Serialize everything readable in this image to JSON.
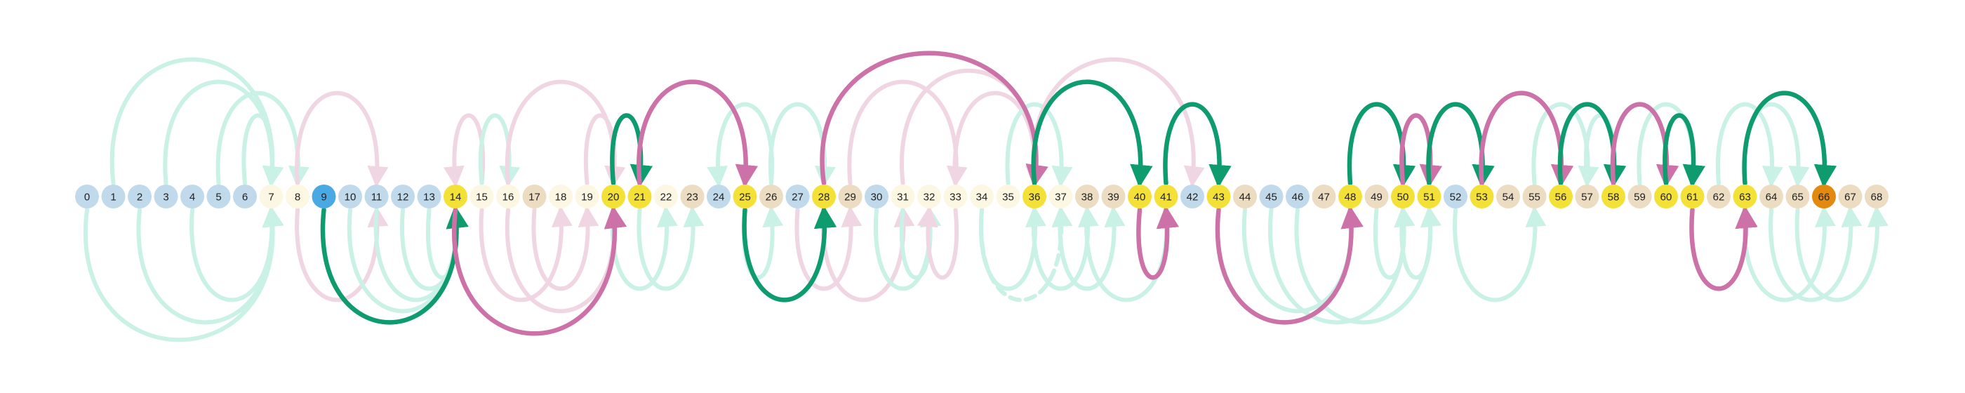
{
  "colors": {
    "green": "#0e9b6e",
    "pink": "#cc72a8",
    "ghost_green": "#c9f1e5",
    "ghost_pink": "#efd6e2",
    "node_blue": "#c0d9eb",
    "node_cream": "#fbf7e2",
    "node_tan": "#ecdcc2",
    "node_yellow": "#f4e137",
    "node_start": "#4aa9e2",
    "node_goal": "#e3890f"
  },
  "nodes": [
    {
      "label": "0",
      "kind": "blue"
    },
    {
      "label": "1",
      "kind": "blue"
    },
    {
      "label": "2",
      "kind": "blue"
    },
    {
      "label": "3",
      "kind": "blue"
    },
    {
      "label": "4",
      "kind": "blue"
    },
    {
      "label": "5",
      "kind": "blue"
    },
    {
      "label": "6",
      "kind": "blue"
    },
    {
      "label": "7",
      "kind": "cream"
    },
    {
      "label": "8",
      "kind": "cream"
    },
    {
      "label": "9",
      "kind": "start"
    },
    {
      "label": "10",
      "kind": "blue"
    },
    {
      "label": "11",
      "kind": "blue"
    },
    {
      "label": "12",
      "kind": "blue"
    },
    {
      "label": "13",
      "kind": "blue"
    },
    {
      "label": "14",
      "kind": "yellow"
    },
    {
      "label": "15",
      "kind": "cream"
    },
    {
      "label": "16",
      "kind": "cream"
    },
    {
      "label": "17",
      "kind": "tan"
    },
    {
      "label": "18",
      "kind": "cream"
    },
    {
      "label": "19",
      "kind": "cream"
    },
    {
      "label": "20",
      "kind": "yellow"
    },
    {
      "label": "21",
      "kind": "yellow"
    },
    {
      "label": "22",
      "kind": "cream"
    },
    {
      "label": "23",
      "kind": "tan"
    },
    {
      "label": "24",
      "kind": "blue"
    },
    {
      "label": "25",
      "kind": "yellow"
    },
    {
      "label": "26",
      "kind": "tan"
    },
    {
      "label": "27",
      "kind": "blue"
    },
    {
      "label": "28",
      "kind": "yellow"
    },
    {
      "label": "29",
      "kind": "tan"
    },
    {
      "label": "30",
      "kind": "blue"
    },
    {
      "label": "31",
      "kind": "cream"
    },
    {
      "label": "32",
      "kind": "cream"
    },
    {
      "label": "33",
      "kind": "cream"
    },
    {
      "label": "34",
      "kind": "cream"
    },
    {
      "label": "35",
      "kind": "cream"
    },
    {
      "label": "36",
      "kind": "yellow"
    },
    {
      "label": "37",
      "kind": "cream"
    },
    {
      "label": "38",
      "kind": "tan"
    },
    {
      "label": "39",
      "kind": "tan"
    },
    {
      "label": "40",
      "kind": "yellow"
    },
    {
      "label": "41",
      "kind": "yellow"
    },
    {
      "label": "42",
      "kind": "blue"
    },
    {
      "label": "43",
      "kind": "yellow"
    },
    {
      "label": "44",
      "kind": "tan"
    },
    {
      "label": "45",
      "kind": "blue"
    },
    {
      "label": "46",
      "kind": "blue"
    },
    {
      "label": "47",
      "kind": "tan"
    },
    {
      "label": "48",
      "kind": "yellow"
    },
    {
      "label": "49",
      "kind": "tan"
    },
    {
      "label": "50",
      "kind": "yellow"
    },
    {
      "label": "51",
      "kind": "yellow"
    },
    {
      "label": "52",
      "kind": "blue"
    },
    {
      "label": "53",
      "kind": "yellow"
    },
    {
      "label": "54",
      "kind": "tan"
    },
    {
      "label": "55",
      "kind": "tan"
    },
    {
      "label": "56",
      "kind": "yellow"
    },
    {
      "label": "57",
      "kind": "tan"
    },
    {
      "label": "58",
      "kind": "yellow"
    },
    {
      "label": "59",
      "kind": "tan"
    },
    {
      "label": "60",
      "kind": "yellow"
    },
    {
      "label": "61",
      "kind": "yellow"
    },
    {
      "label": "62",
      "kind": "tan"
    },
    {
      "label": "63",
      "kind": "yellow"
    },
    {
      "label": "64",
      "kind": "tan"
    },
    {
      "label": "65",
      "kind": "tan"
    },
    {
      "label": "66",
      "kind": "goal"
    },
    {
      "label": "67",
      "kind": "tan"
    },
    {
      "label": "68",
      "kind": "tan"
    }
  ],
  "arcs_highlight": [
    {
      "from": 9,
      "to": 14,
      "side": "below",
      "color": "green"
    },
    {
      "from": 14,
      "to": 20,
      "side": "below",
      "color": "pink"
    },
    {
      "from": 20,
      "to": 21,
      "side": "above",
      "color": "green"
    },
    {
      "from": 21,
      "to": 25,
      "side": "above",
      "color": "pink"
    },
    {
      "from": 25,
      "to": 28,
      "side": "below",
      "color": "green"
    },
    {
      "from": 28,
      "to": 36,
      "side": "above",
      "color": "pink"
    },
    {
      "from": 36,
      "to": 40,
      "side": "above",
      "color": "green"
    },
    {
      "from": 40,
      "to": 41,
      "side": "below",
      "color": "pink"
    },
    {
      "from": 41,
      "to": 43,
      "side": "above",
      "color": "green"
    },
    {
      "from": 43,
      "to": 48,
      "side": "below",
      "color": "pink"
    },
    {
      "from": 48,
      "to": 50,
      "side": "above",
      "color": "green"
    },
    {
      "from": 50,
      "to": 51,
      "side": "above",
      "color": "pink"
    },
    {
      "from": 51,
      "to": 53,
      "side": "above",
      "color": "green"
    },
    {
      "from": 53,
      "to": 56,
      "side": "above",
      "color": "pink"
    },
    {
      "from": 56,
      "to": 58,
      "side": "above",
      "color": "green"
    },
    {
      "from": 58,
      "to": 60,
      "side": "above",
      "color": "pink"
    },
    {
      "from": 60,
      "to": 61,
      "side": "above",
      "color": "green"
    },
    {
      "from": 61,
      "to": 63,
      "side": "below",
      "color": "pink"
    },
    {
      "from": 63,
      "to": 66,
      "side": "above",
      "color": "green"
    }
  ],
  "arcs_ghost": [
    {
      "from": 1,
      "to": 7,
      "side": "above",
      "color": "ghost_green"
    },
    {
      "from": 3,
      "to": 7,
      "side": "above",
      "color": "ghost_green"
    },
    {
      "from": 5,
      "to": 8,
      "side": "above",
      "color": "ghost_green"
    },
    {
      "from": 6,
      "to": 7,
      "side": "above",
      "color": "ghost_green"
    },
    {
      "from": 8,
      "to": 11,
      "side": "above",
      "color": "ghost_pink"
    },
    {
      "from": 0,
      "to": 7,
      "side": "below",
      "color": "ghost_green"
    },
    {
      "from": 2,
      "to": 7,
      "side": "below",
      "color": "ghost_green"
    },
    {
      "from": 4,
      "to": 7,
      "side": "below",
      "color": "ghost_green"
    },
    {
      "from": 8,
      "to": 11,
      "side": "below",
      "color": "ghost_pink"
    },
    {
      "from": 10,
      "to": 14,
      "side": "below",
      "color": "ghost_green"
    },
    {
      "from": 11,
      "to": 14,
      "side": "below",
      "color": "ghost_green"
    },
    {
      "from": 12,
      "to": 14,
      "side": "below",
      "color": "ghost_green"
    },
    {
      "from": 13,
      "to": 14,
      "side": "below",
      "color": "ghost_green"
    },
    {
      "from": 15,
      "to": 14,
      "side": "above",
      "color": "ghost_pink"
    },
    {
      "from": 15,
      "to": 16,
      "side": "above",
      "color": "ghost_green"
    },
    {
      "from": 16,
      "to": 20,
      "side": "above",
      "color": "ghost_pink"
    },
    {
      "from": 19,
      "to": 20,
      "side": "above",
      "color": "ghost_pink"
    },
    {
      "from": 21,
      "to": 25,
      "side": "above",
      "color": "ghost_pink"
    },
    {
      "from": 15,
      "to": 18,
      "side": "below",
      "color": "ghost_pink"
    },
    {
      "from": 16,
      "to": 20,
      "side": "below",
      "color": "ghost_pink"
    },
    {
      "from": 17,
      "to": 19,
      "side": "below",
      "color": "ghost_pink"
    },
    {
      "from": 20,
      "to": 22,
      "side": "below",
      "color": "ghost_green"
    },
    {
      "from": 21,
      "to": 23,
      "side": "below",
      "color": "ghost_green"
    },
    {
      "from": 26,
      "to": 28,
      "side": "above",
      "color": "ghost_green"
    },
    {
      "from": 26,
      "to": 24,
      "side": "above",
      "color": "ghost_green"
    },
    {
      "from": 29,
      "to": 33,
      "side": "above",
      "color": "ghost_pink"
    },
    {
      "from": 31,
      "to": 36,
      "side": "above",
      "color": "ghost_pink"
    },
    {
      "from": 33,
      "to": 36,
      "side": "above",
      "color": "ghost_pink"
    },
    {
      "from": 35,
      "to": 37,
      "side": "above",
      "color": "ghost_green"
    },
    {
      "from": 36,
      "to": 42,
      "side": "above",
      "color": "ghost_pink"
    },
    {
      "from": 25,
      "to": 26,
      "side": "below",
      "color": "ghost_green"
    },
    {
      "from": 27,
      "to": 29,
      "side": "below",
      "color": "ghost_pink"
    },
    {
      "from": 28,
      "to": 31,
      "side": "below",
      "color": "ghost_pink"
    },
    {
      "from": 30,
      "to": 32,
      "side": "below",
      "color": "ghost_green"
    },
    {
      "from": 31,
      "to": 32,
      "side": "below",
      "color": "ghost_green"
    },
    {
      "from": 33,
      "to": 32,
      "side": "below",
      "color": "ghost_pink"
    },
    {
      "from": 34,
      "to": 36,
      "side": "below",
      "color": "ghost_green"
    },
    {
      "from": 36,
      "to": 38,
      "side": "below",
      "color": "ghost_green"
    },
    {
      "from": 37,
      "to": 39,
      "side": "below",
      "color": "ghost_green"
    },
    {
      "from": 38,
      "to": 41,
      "side": "below",
      "color": "ghost_green"
    },
    {
      "from": 44,
      "to": 48,
      "side": "below",
      "color": "ghost_green"
    },
    {
      "from": 45,
      "to": 50,
      "side": "below",
      "color": "ghost_green"
    },
    {
      "from": 46,
      "to": 51,
      "side": "below",
      "color": "ghost_green"
    },
    {
      "from": 49,
      "to": 50,
      "side": "below",
      "color": "ghost_green"
    },
    {
      "from": 50,
      "to": 51,
      "side": "below",
      "color": "ghost_green"
    },
    {
      "from": 52,
      "to": 55,
      "side": "below",
      "color": "ghost_green"
    },
    {
      "from": 53,
      "to": 56,
      "side": "above",
      "color": "ghost_green"
    },
    {
      "from": 55,
      "to": 57,
      "side": "above",
      "color": "ghost_green"
    },
    {
      "from": 57,
      "to": 58,
      "side": "above",
      "color": "ghost_green"
    },
    {
      "from": 59,
      "to": 61,
      "side": "above",
      "color": "ghost_green"
    },
    {
      "from": 62,
      "to": 64,
      "side": "above",
      "color": "ghost_green"
    },
    {
      "from": 63,
      "to": 65,
      "side": "above",
      "color": "ghost_green"
    },
    {
      "from": 63,
      "to": 66,
      "side": "below",
      "color": "ghost_green"
    },
    {
      "from": 64,
      "to": 67,
      "side": "below",
      "color": "ghost_green"
    },
    {
      "from": 65,
      "to": 68,
      "side": "below",
      "color": "ghost_green"
    }
  ],
  "arcs_dashed": [
    {
      "from": 34,
      "to": 37,
      "side": "below",
      "color": "ghost_green"
    },
    {
      "from": 37,
      "to": 39,
      "side": "below",
      "color": "ghost_green"
    }
  ]
}
